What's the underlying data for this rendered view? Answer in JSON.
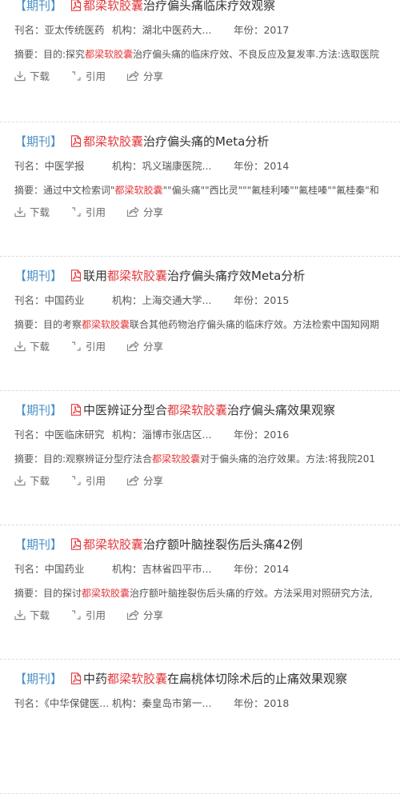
{
  "strings": {
    "tag": "【期刊】",
    "journal_label": "刊名：",
    "institution_label": "机构：",
    "year_label": "年份：",
    "abstract_label": "摘要：",
    "download": "下载",
    "cite": "引用",
    "share": "分享"
  },
  "colors": {
    "tag": "#4a90c8",
    "highlight": "#e4393c",
    "pdf_icon": "#e4393c",
    "divider": "#dcdcdc"
  },
  "results": [
    {
      "title": [
        {
          "text": "都梁软胶囊",
          "hl": true
        },
        {
          "text": "治疗偏头痛临床疗效观察",
          "hl": false
        }
      ],
      "journal": "亚太传统医药",
      "institution": "湖北中医药大...",
      "year": "2017",
      "abstract": [
        {
          "text": "目的:探究",
          "hl": false
        },
        {
          "text": "都梁软胶囊",
          "hl": true
        },
        {
          "text": "治疗偏头痛的临床疗效、不良反应及复发率.方法:选取医院",
          "hl": false
        }
      ]
    },
    {
      "title": [
        {
          "text": "都梁软胶囊",
          "hl": true
        },
        {
          "text": "治疗偏头痛的Meta分析",
          "hl": false
        }
      ],
      "journal": "中医学报",
      "institution": "巩义瑞康医院...",
      "year": "2014",
      "abstract": [
        {
          "text": "通过中文检索词\"",
          "hl": false
        },
        {
          "text": "都梁软胶囊",
          "hl": true
        },
        {
          "text": "\"\"偏头痛\"\"西比灵\"\"\"氟桂利嗪\"\"氟桂嗪\"\"氟桂秦\"和",
          "hl": false
        }
      ]
    },
    {
      "title": [
        {
          "text": "联用",
          "hl": false
        },
        {
          "text": "都梁软胶囊",
          "hl": true
        },
        {
          "text": "治疗偏头痛疗效Meta分析",
          "hl": false
        }
      ],
      "journal": "中国药业",
      "institution": "上海交通大学...",
      "year": "2015",
      "abstract": [
        {
          "text": "目的考察",
          "hl": false
        },
        {
          "text": "都梁软胶囊",
          "hl": true
        },
        {
          "text": "联合其他药物治疗偏头痛的临床疗效。方法检索中国知网期",
          "hl": false
        }
      ]
    },
    {
      "title": [
        {
          "text": "中医辨证分型合",
          "hl": false
        },
        {
          "text": "都梁软胶囊",
          "hl": true
        },
        {
          "text": "治疗偏头痛效果观察",
          "hl": false
        }
      ],
      "journal": "中医临床研究",
      "institution": "淄博市张店区...",
      "year": "2016",
      "abstract": [
        {
          "text": "目的:观察辨证分型疗法合",
          "hl": false
        },
        {
          "text": "都梁软胶囊",
          "hl": true
        },
        {
          "text": "对于偏头痛的治疗效果。方法:将我院201",
          "hl": false
        }
      ]
    },
    {
      "title": [
        {
          "text": "都梁软胶囊",
          "hl": true
        },
        {
          "text": "治疗额叶脑挫裂伤后头痛42例",
          "hl": false
        }
      ],
      "journal": "中国药业",
      "institution": "吉林省四平市...",
      "year": "2014",
      "abstract": [
        {
          "text": "目的探讨",
          "hl": false
        },
        {
          "text": "都梁软胶囊",
          "hl": true
        },
        {
          "text": "治疗额叶脑挫裂伤后头痛的疗效。方法采用对照研究方法,",
          "hl": false
        }
      ]
    },
    {
      "title": [
        {
          "text": "中药",
          "hl": false
        },
        {
          "text": "都梁软胶囊",
          "hl": true
        },
        {
          "text": "在扁桃体切除术后的止痛效果观察",
          "hl": false
        }
      ],
      "journal": "《中华保健医...",
      "institution": "秦皇岛市第一...",
      "year": "2018",
      "abstract": []
    }
  ]
}
